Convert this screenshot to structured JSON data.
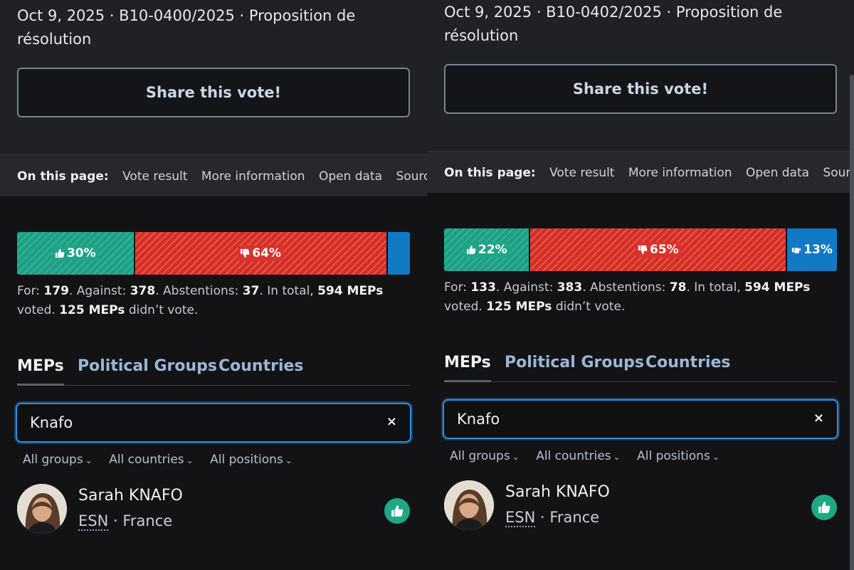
{
  "panels": [
    {
      "meta_line": "Oct 9, 2025 · B10-0400/2025 · Proposition de résolution",
      "share_label": "Share this vote!",
      "on_this_page": {
        "title": "On this page:",
        "links": [
          "Vote result",
          "More information",
          "Open data",
          "Sources"
        ]
      },
      "result": {
        "for_pct": 30,
        "against_pct": 64,
        "abst_pct": 6,
        "for_label": "30%",
        "against_label": "64%",
        "abst_label": "",
        "for_count": "179",
        "against_count": "378",
        "abst_count": "37",
        "total": "594 MEPs",
        "absent": "125 MEPs"
      },
      "tabs": [
        "MEPs",
        "Political Groups",
        "Countries"
      ],
      "search_value": "Knafo",
      "clear_symbol": "×",
      "filters": [
        "All groups",
        "All countries",
        "All positions"
      ],
      "mep": {
        "name": "Sarah KNAFO",
        "group": "ESN",
        "country": "France",
        "position_icon": "thumbs-up-icon"
      }
    },
    {
      "meta_line": "Oct 9, 2025 · B10-0402/2025 · Proposition de résolution",
      "share_label": "Share this vote!",
      "on_this_page": {
        "title": "On this page:",
        "links": [
          "Vote result",
          "More information",
          "Open data",
          "Sources"
        ]
      },
      "result": {
        "for_pct": 22,
        "against_pct": 65,
        "abst_pct": 13,
        "for_label": "22%",
        "against_label": "65%",
        "abst_label": "13%",
        "for_count": "133",
        "against_count": "383",
        "abst_count": "78",
        "total": "594 MEPs",
        "absent": "125 MEPs"
      },
      "tabs": [
        "MEPs",
        "Political Groups",
        "Countries"
      ],
      "search_value": "Knafo",
      "clear_symbol": "×",
      "filters": [
        "All groups",
        "All countries",
        "All positions"
      ],
      "mep": {
        "name": "Sarah KNAFO",
        "group": "ESN",
        "country": "France",
        "position_icon": "thumbs-up-icon"
      }
    }
  ],
  "labels": {
    "for": "For:",
    "against": "Against:",
    "abstentions": "Abstentions:",
    "in_total": "In total,",
    "voted": "voted.",
    "didnt_vote": "didn’t vote."
  },
  "colors": {
    "for": "#1f9e84",
    "against": "#d42f25",
    "abstention": "#1279c4",
    "accent": "#2d8ee0"
  }
}
